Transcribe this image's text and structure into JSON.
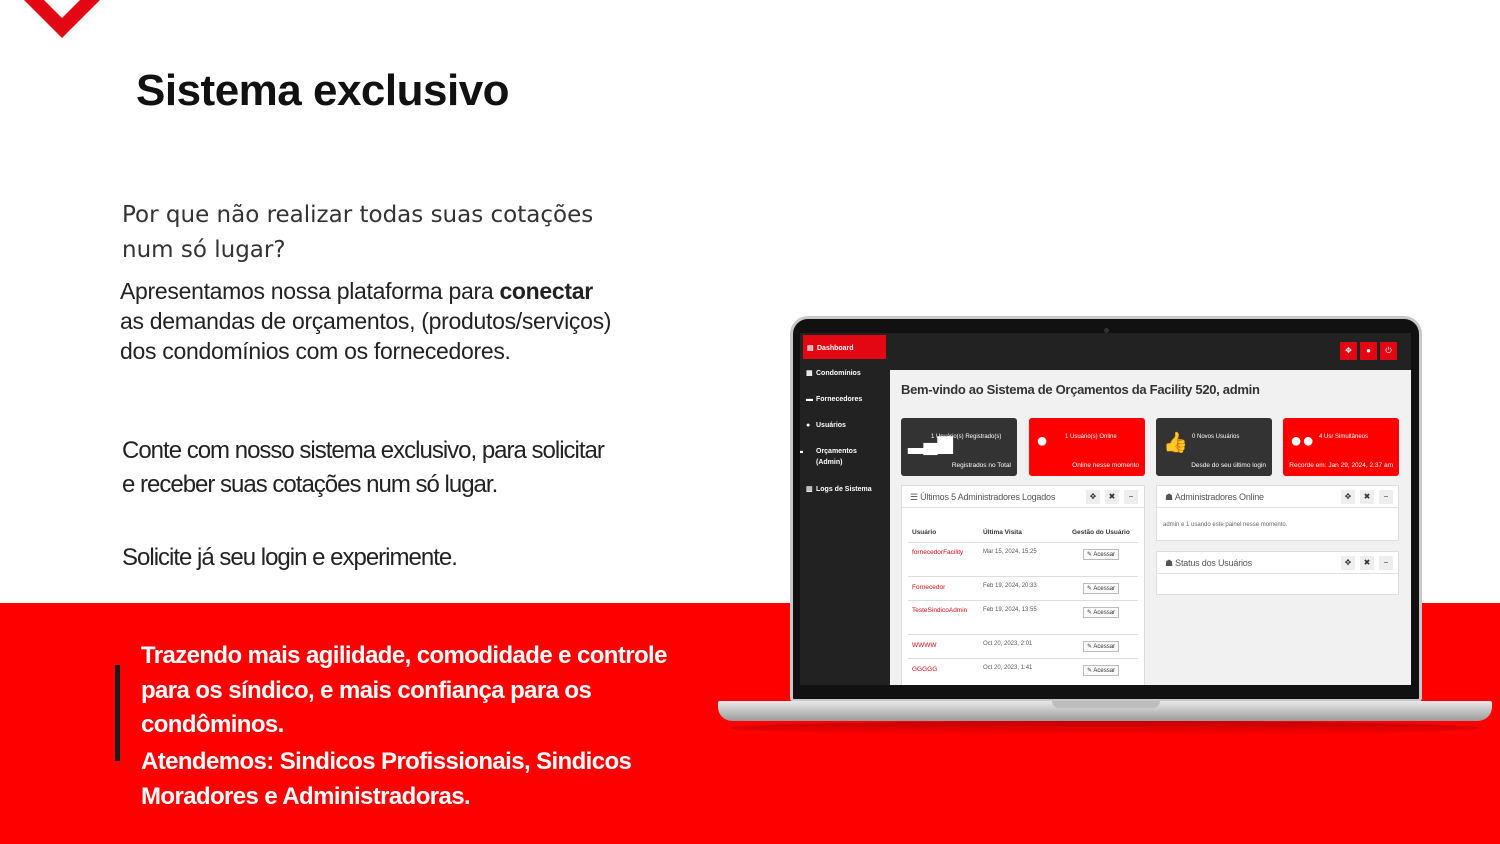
{
  "slide": {
    "title": "Sistema exclusivo",
    "question_line1": "Por que não realizar todas suas cotações",
    "question_line2": "num só lugar?",
    "para1_pre": "Apresentamos nossa plataforma para ",
    "para1_bold": "conectar",
    "para1_line2": "as demandas de orçamentos, (produtos/serviços)",
    "para1_line3": "dos condomínios com os fornecedores.",
    "cta_line1": "Conte com nosso sistema exclusivo, para solicitar",
    "cta_line2": "e receber suas cotações num só lugar.",
    "login_line": "Solicite já seu login e experimente.",
    "band_line1": "Trazendo mais agilidade, comodidade e controle",
    "band_line2": "para os síndico, e mais confiança para os",
    "band_line3": "condôminos.",
    "band_line4": "Atendemos: Sindicos Profissionais, Sindicos",
    "band_line5": "Moradores e Administradoras.",
    "brand_color": "#e30613",
    "band_color": "#ff0000"
  },
  "app": {
    "sidebar": [
      {
        "label": "Dashboard",
        "icon": "dashboard-icon"
      },
      {
        "label": "Condomínios",
        "icon": "building-icon"
      },
      {
        "label": "Fornecedores",
        "icon": "briefcase-icon"
      },
      {
        "label": "Usuários",
        "icon": "user-icon"
      },
      {
        "label": "Orçamentos (Admin)",
        "icon": "briefcase-icon"
      },
      {
        "label": "Logs de Sistema",
        "icon": "chart-icon"
      }
    ],
    "welcome": "Bem-vindo ao Sistema de Orçamentos da Facility 520, admin",
    "cards": [
      {
        "top": "1 Usuário(s) Registrado(s)",
        "bottom": "Registrados no Total",
        "icon": "signal-icon",
        "style": "dark"
      },
      {
        "top": "1 Usuário(s) Online",
        "bottom": "Online nesse momento",
        "icon": "user-icon",
        "style": "red"
      },
      {
        "top": "0 Novos Usuários",
        "bottom": "Desde do seu último login",
        "icon": "thumbs-up-icon",
        "style": "dark"
      },
      {
        "top": "4 Usr Simultâneos",
        "bottom": "Recorde em: Jan 29, 2024, 2:37 am",
        "icon": "users-icon",
        "style": "red"
      }
    ],
    "admins_panel": {
      "title": "Últimos 5 Administradores Logados",
      "col_user": "Usuário",
      "col_last": "Última Visita",
      "col_manage": "Gestão do Usuário",
      "action_label": "Acessar",
      "rows": [
        {
          "user": "fornecedorFacility",
          "date": "Mar 15, 2024, 15:25"
        },
        {
          "user": "Fornecedor",
          "date": "Feb 19, 2024, 20:33"
        },
        {
          "user": "TesteSindicoAdmin",
          "date": "Feb 19, 2024, 13:55"
        },
        {
          "user": "WWWW",
          "date": "Oct 20, 2023, 2:01"
        },
        {
          "user": "GGGGG",
          "date": "Oct 20, 2023, 1:41"
        }
      ]
    },
    "online_panel": {
      "title": "Administradores Online",
      "text": "admin e 1 usando este painel nesse momento."
    },
    "status_panel": {
      "title": "Status dos Usuários"
    }
  }
}
